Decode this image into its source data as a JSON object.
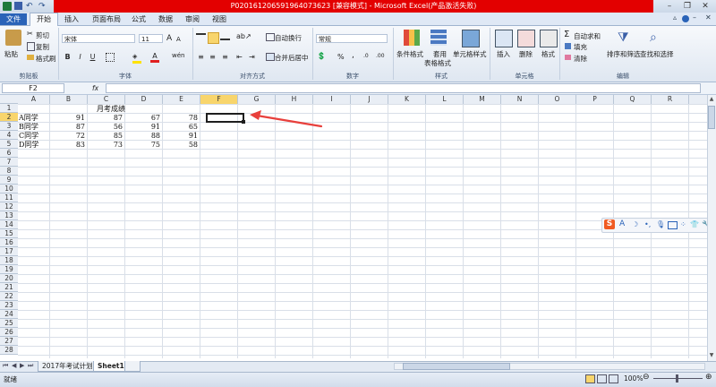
{
  "window": {
    "title": "P020161206591964073623 [兼容模式] - Microsoft Excel(产品激活失败)",
    "minimize_glyph": "–",
    "restore_glyph": "❐",
    "close_glyph": "✕"
  },
  "quick_access": {
    "undo_glyph": "↶",
    "redo_glyph": "↷"
  },
  "tabs": [
    {
      "label": "文件"
    },
    {
      "label": "开始"
    },
    {
      "label": "插入"
    },
    {
      "label": "页面布局"
    },
    {
      "label": "公式"
    },
    {
      "label": "数据"
    },
    {
      "label": "审阅"
    },
    {
      "label": "视图"
    }
  ],
  "ribbon": {
    "clipboard": {
      "paste": "粘贴",
      "cut": "剪切",
      "copy": "复制",
      "format_painter": "格式刷",
      "label": "剪贴板"
    },
    "font": {
      "name": "宋体",
      "size": "11",
      "bold": "B",
      "italic": "I",
      "underline": "U",
      "label": "字体",
      "grow": "A",
      "shrink": "A"
    },
    "alignment": {
      "wrap": "自动换行",
      "merge": "合并后居中",
      "label": "对齐方式"
    },
    "number": {
      "format": "常规",
      "percent": "%",
      "comma": ",",
      "label": "数字"
    },
    "styles": {
      "conditional": "条件格式",
      "table_line1": "套用",
      "table_line2": "表格格式",
      "cell_styles": "单元格样式",
      "label": "样式"
    },
    "cells": {
      "insert": "插入",
      "delete": "删除",
      "format": "格式",
      "label": "单元格"
    },
    "editing": {
      "autosum": "自动求和",
      "fill": "填充",
      "clear": "清除",
      "sort": "排序和筛选",
      "find": "查找和选择",
      "label": "编辑",
      "sigma": "Σ"
    }
  },
  "formula_bar": {
    "name_box": "F2",
    "fx": "fx"
  },
  "columns": [
    "A",
    "B",
    "C",
    "D",
    "E",
    "F",
    "G",
    "H",
    "I",
    "J",
    "K",
    "L",
    "M",
    "N",
    "O",
    "P",
    "Q",
    "R"
  ],
  "rows": [
    "1",
    "2",
    "3",
    "4",
    "5",
    "6",
    "7",
    "8",
    "9",
    "10",
    "11",
    "12",
    "13",
    "14",
    "15",
    "16",
    "17",
    "18",
    "19",
    "20",
    "21",
    "22",
    "23",
    "24",
    "25",
    "26",
    "27",
    "28"
  ],
  "sheet": {
    "title_cell": "月考成绩",
    "data": [
      [
        "A同学",
        "91",
        "87",
        "67",
        "78"
      ],
      [
        "B同学",
        "87",
        "56",
        "91",
        "65"
      ],
      [
        "C同学",
        "72",
        "85",
        "88",
        "91"
      ],
      [
        "D同学",
        "83",
        "73",
        "75",
        "58"
      ]
    ]
  },
  "sheet_tabs": [
    {
      "label": "2017年考试计划"
    },
    {
      "label": "Sheet1"
    }
  ],
  "status": {
    "ready": "就绪",
    "zoom": "100%"
  },
  "ime_toolbar": {
    "logo": "S",
    "a": "A"
  },
  "colors": {
    "title_red": "#e30000",
    "selected_header": "#f8d56c",
    "arrow": "#e8403c",
    "file_tab": "#2a63b8"
  }
}
